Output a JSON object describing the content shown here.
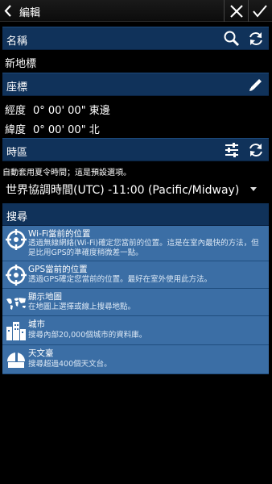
{
  "topbar": {
    "title": "編輯"
  },
  "name_section": {
    "label": "名稱",
    "value": "新地標"
  },
  "coord_section": {
    "label": "座標",
    "longitude_label": "經度",
    "longitude_value": "0° 00' 00\" 東邊",
    "latitude_label": "緯度",
    "latitude_value": "0° 00' 00\" 北"
  },
  "timezone_section": {
    "label": "時區",
    "note": "自動套用夏令時間；這是預設選項。",
    "selected": "世界協調時間(UTC) -11:00 (Pacific/Midway)"
  },
  "search": {
    "label": "搜尋",
    "items": [
      {
        "title": "Wi-Fi當前的位置",
        "desc": "透過無線網絡(Wi-Fi)確定您當前的位置。這是在室內最快的方法，但是比用GPS的準確度稍微差一點。",
        "icon": "wifi-location-icon"
      },
      {
        "title": "GPS當前的位置",
        "desc": "透過GPS確定您當前的位置。最好在室外使用此方法。",
        "icon": "gps-location-icon"
      },
      {
        "title": "顯示地圖",
        "desc": "在地圖上選擇或線上搜尋地點。",
        "icon": "world-map-icon"
      },
      {
        "title": "城市",
        "desc": "搜尋內部20,000個城市的資料庫。",
        "icon": "city-icon"
      },
      {
        "title": "天文臺",
        "desc": "搜尋超過400個天文台。",
        "icon": "observatory-icon"
      }
    ]
  }
}
